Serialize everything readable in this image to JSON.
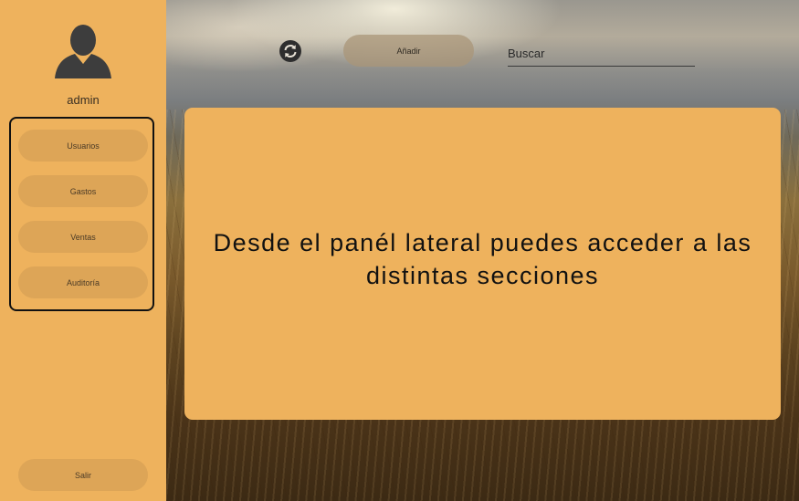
{
  "sidebar": {
    "username": "admin",
    "nav_items": [
      {
        "label": "Usuarios"
      },
      {
        "label": "Gastos"
      },
      {
        "label": "Ventas"
      },
      {
        "label": "Auditoría"
      }
    ],
    "logout_label": "Salir",
    "avatar_icon": "user-icon"
  },
  "toolbar": {
    "refresh_icon": "refresh-icon",
    "add_label": "Añadir",
    "search_placeholder": "Buscar"
  },
  "main": {
    "message": "Desde el panél lateral puedes acceder a las distintas secciones"
  },
  "colors": {
    "accent": "#eeb25d",
    "button": "#dda557",
    "text": "#111111"
  }
}
